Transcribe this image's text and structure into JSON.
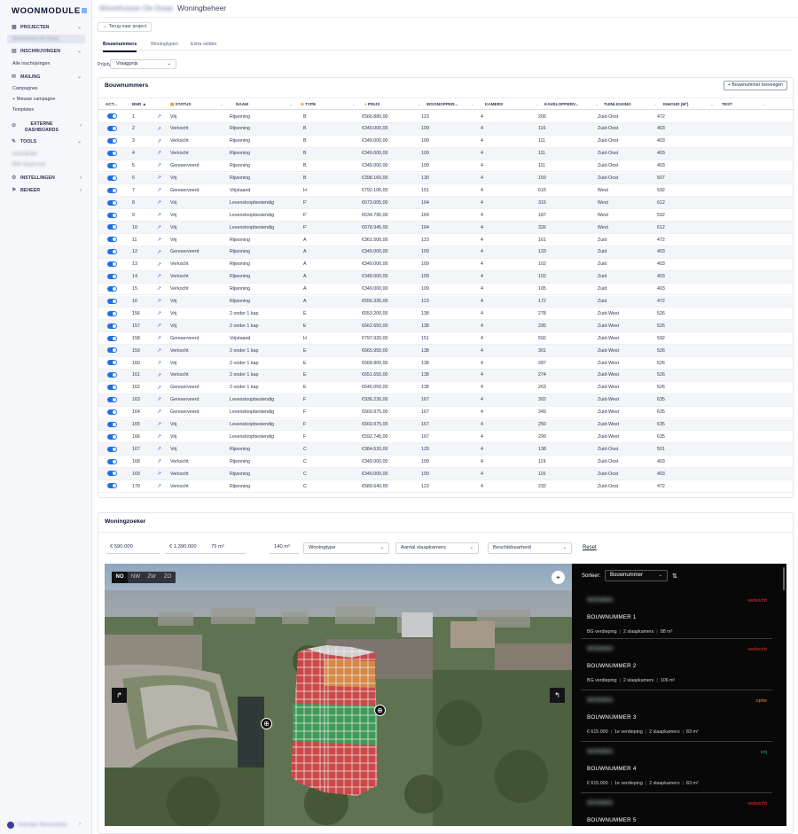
{
  "app": {
    "logo": "WOONMODULE",
    "breadcrumb_blurred": "Woonhuizen De Draai",
    "page_title": "Woningbeheer"
  },
  "sidebar": {
    "projects": "PROJECTEN",
    "project_item": "Woonhuizen De Draai",
    "registrations": "INSCHRIJVINGEN",
    "all_registrations": "Alle inschrijvingen",
    "mailing": "MAILING",
    "campaigns": "Campagnes",
    "new_campaign": "+ Nieuwe campagne",
    "templates": "Templates",
    "external": "EXTERNE DASHBOARDS",
    "tools": "TOOLS",
    "tool1": "Inschrijf-lijst",
    "tool2": "PDF Export tool",
    "settings": "INSTELLINGEN",
    "manage": "BEHEER",
    "user": "Gebruiker Woonmodule"
  },
  "back_button": "← Terug naar project",
  "tabs": [
    "Bouwnummers",
    "Woningtypen",
    "Extra velden"
  ],
  "price_type": {
    "label": "Prijstype:",
    "value": "Vraagprijs"
  },
  "table": {
    "title": "Bouwnummers",
    "add_button": "+ Bouwnummer toevoegen",
    "headers": [
      "ACT...",
      "BNR ▲",
      "STATUS",
      "NAAM",
      "TYPE",
      "PRIJS",
      "WOONOPPER...",
      "KAMERS",
      "KAVELOPPERV...",
      "TUINLIGGING",
      "INHOUD (M³)",
      "TEST"
    ],
    "rows": [
      [
        "1",
        "Vrij",
        "Rijwoning",
        "B",
        "€566.880,00",
        "123",
        "4",
        "205",
        "Zuid-Oost",
        "472"
      ],
      [
        "2",
        "Verkocht",
        "Rijwoning",
        "B",
        "€349.000,00",
        "109",
        "4",
        "116",
        "Zuid-Oost",
        "403"
      ],
      [
        "3",
        "Verkocht",
        "Rijwoning",
        "B",
        "€349.000,00",
        "109",
        "4",
        "111",
        "Zuid-Oost",
        "403"
      ],
      [
        "4",
        "Verkocht",
        "Rijwoning",
        "B",
        "€349.000,00",
        "109",
        "4",
        "111",
        "Zuid-Oost",
        "403"
      ],
      [
        "5",
        "Gereserveerd",
        "Rijwoning",
        "B",
        "€349.000,00",
        "109",
        "4",
        "111",
        "Zuid-Oost",
        "403"
      ],
      [
        "6",
        "Vrij",
        "Rijwoning",
        "B",
        "€398.160,00",
        "130",
        "4",
        "159",
        "Zuid-Oost",
        "507"
      ],
      [
        "7",
        "Gereserveerd",
        "Vrijstaand",
        "H",
        "€792.106,00",
        "151",
        "4",
        "616",
        "West",
        "592"
      ],
      [
        "8",
        "Vrij",
        "Levensloopbestendig",
        "F'",
        "€673.005,00",
        "164",
        "4",
        "315",
        "West",
        "612"
      ],
      [
        "9",
        "Vrij",
        "Levensloopbestendig",
        "F'",
        "€634.790,00",
        "164",
        "4",
        "187",
        "West",
        "592"
      ],
      [
        "10",
        "Vrij",
        "Levensloopbestendig",
        "F'",
        "€678.945,00",
        "164",
        "4",
        "326",
        "West",
        "612"
      ],
      [
        "11",
        "Vrij",
        "Rijwoning",
        "A",
        "€361.500,00",
        "123",
        "4",
        "161",
        "Zuid",
        "472"
      ],
      [
        "12",
        "Gereserveerd",
        "Rijwoning",
        "A",
        "€349.000,00",
        "109",
        "4",
        "133",
        "Zuid",
        "403"
      ],
      [
        "13",
        "Verkocht",
        "Rijwoning",
        "A",
        "€349.000,00",
        "109",
        "4",
        "102",
        "Zuid",
        "403"
      ],
      [
        "14",
        "Verkocht",
        "Rijwoning",
        "A",
        "€349.000,00",
        "109",
        "4",
        "102",
        "Zuid",
        "403"
      ],
      [
        "15",
        "Verkocht",
        "Rijwoning",
        "A",
        "€349.000,00",
        "109",
        "4",
        "105",
        "Zuid",
        "403"
      ],
      [
        "16",
        "Vrij",
        "Rijwoning",
        "A",
        "€556.335,00",
        "123",
        "4",
        "172",
        "Zuid",
        "472"
      ],
      [
        "156",
        "Vrij",
        "2 onder 1 kap",
        "E",
        "€653.200,00",
        "138",
        "4",
        "278",
        "Zuid-West",
        "526"
      ],
      [
        "157",
        "Vrij",
        "2 onder 1 kap",
        "E",
        "€662.650,00",
        "138",
        "4",
        "295",
        "Zuid-West",
        "526"
      ],
      [
        "158",
        "Gereserveerd",
        "Vrijstaand",
        "H",
        "€797.920,00",
        "151",
        "4",
        "592",
        "Zuid-West",
        "592"
      ],
      [
        "159",
        "Verkocht",
        "2 onder 1 kap",
        "E",
        "€665.950,00",
        "138",
        "4",
        "301",
        "Zuid-West",
        "526"
      ],
      [
        "160",
        "Vrij",
        "2 onder 1 kap",
        "E",
        "€668.800,00",
        "138",
        "4",
        "287",
        "Zuid-West",
        "526"
      ],
      [
        "161",
        "Verkocht",
        "2 onder 1 kap",
        "E",
        "€651.650,00",
        "138",
        "4",
        "274",
        "Zuid-West",
        "526"
      ],
      [
        "162",
        "Gereserveerd",
        "2 onder 1 kap",
        "E",
        "€646.050,00",
        "138",
        "4",
        "263",
        "Zuid-West",
        "526"
      ],
      [
        "163",
        "Gereserveerd",
        "Levensloopbestendig",
        "F",
        "€936.230,00",
        "167",
        "4",
        "302",
        "Zuid-West",
        "635"
      ],
      [
        "164",
        "Gereserveerd",
        "Levensloopbestendig",
        "F",
        "€669.975,00",
        "167",
        "4",
        "349",
        "Zuid-West",
        "635"
      ],
      [
        "165",
        "Vrij",
        "Levensloopbestendig",
        "F",
        "€669.975,00",
        "167",
        "4",
        "250",
        "Zuid-West",
        "635"
      ],
      [
        "166",
        "Vrij",
        "Levensloopbestendig",
        "F",
        "€592.745,00",
        "167",
        "4",
        "299",
        "Zuid-West",
        "635"
      ],
      [
        "167",
        "Vrij",
        "Rijwoning",
        "C",
        "€384.620,00",
        "129",
        "4",
        "138",
        "Zuid-Oost",
        "501"
      ],
      [
        "168",
        "Verkocht",
        "Rijwoning",
        "C",
        "€349.000,00",
        "109",
        "4",
        "119",
        "Zuid-Oost",
        "403"
      ],
      [
        "169",
        "Verkocht",
        "Rijwoning",
        "C",
        "€349.000,00",
        "109",
        "4",
        "116",
        "Zuid-Oost",
        "403"
      ],
      [
        "170",
        "Verkocht",
        "Rijwoning",
        "C",
        "€589.640,00",
        "123",
        "4",
        "232",
        "Zuid-Oost",
        "472"
      ]
    ]
  },
  "finder": {
    "title": "Woningzoeker",
    "price_min": "€ 590.000",
    "price_max": "€ 1.390.000",
    "area_min": "75 m²",
    "area_max": "140 m²",
    "type": "Woningtype",
    "bedrooms": "Aantal slaapkamers",
    "availability": "Beschikbaarheid",
    "reset": "Reset",
    "directions": [
      "NO",
      "NW",
      "ZW",
      "ZO"
    ],
    "sort_label": "Sorteer:",
    "sort_value": "Bouwnummer",
    "colors": {
      "sold": "#e23b30",
      "option": "#e8862a",
      "free": "#2fb05a"
    },
    "items": [
      {
        "blur": "WONING",
        "status": "verkocht",
        "status_type": "sold",
        "name": "BOUWNUMMER 1",
        "meta": [
          "BG verdieping",
          "2 slaapkamers",
          "88 m²"
        ]
      },
      {
        "blur": "WONING",
        "status": "verkocht",
        "status_type": "sold",
        "name": "BOUWNUMMER 2",
        "meta": [
          "BG verdieping",
          "2 slaapkamers",
          "106 m²"
        ]
      },
      {
        "blur": "WONING",
        "status": "optie",
        "status_type": "option",
        "name": "BOUWNUMMER 3",
        "meta": [
          "€ 615.000",
          "1e verdieping",
          "2 slaapkamers",
          "83 m²"
        ]
      },
      {
        "blur": "WONING",
        "status": "vrij",
        "status_type": "free",
        "name": "BOUWNUMMER 4",
        "meta": [
          "€ 615.000",
          "1e verdieping",
          "2 slaapkamers",
          "83 m²"
        ]
      },
      {
        "blur": "WONING",
        "status": "verkocht",
        "status_type": "sold",
        "name": "BOUWNUMMER 5",
        "meta": []
      }
    ]
  }
}
